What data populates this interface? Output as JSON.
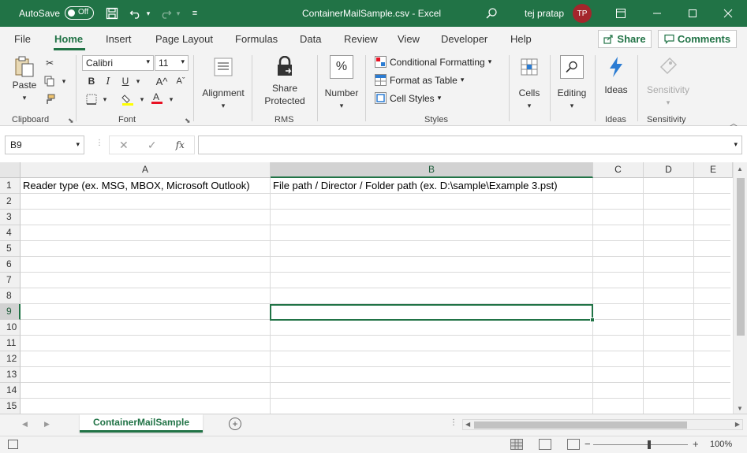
{
  "titlebar": {
    "autosave_label": "AutoSave",
    "autosave_state": "Off",
    "title": "ContainerMailSample.csv  -  Excel",
    "user_name": "tej pratap",
    "user_initials": "TP"
  },
  "tabs": [
    "File",
    "Home",
    "Insert",
    "Page Layout",
    "Formulas",
    "Data",
    "Review",
    "View",
    "Developer",
    "Help"
  ],
  "active_tab": "Home",
  "share_label": "Share",
  "comments_label": "Comments",
  "ribbon": {
    "clipboard": {
      "paste": "Paste",
      "label": "Clipboard"
    },
    "font": {
      "name": "Calibri",
      "size": "11",
      "label": "Font"
    },
    "alignment": {
      "label": "Alignment"
    },
    "rms": {
      "share_protected_1": "Share",
      "share_protected_2": "Protected",
      "label": "RMS"
    },
    "number": {
      "label": "Number"
    },
    "styles": {
      "conditional": "Conditional Formatting",
      "format_table": "Format as Table",
      "cell_styles": "Cell Styles",
      "label": "Styles"
    },
    "cells": {
      "label": "Cells"
    },
    "editing": {
      "label": "Editing"
    },
    "ideas": {
      "button": "Ideas",
      "label": "Ideas"
    },
    "sensitivity": {
      "button": "Sensitivity",
      "label": "Sensitivity"
    }
  },
  "formula_bar": {
    "name_box": "B9",
    "value": ""
  },
  "grid": {
    "columns": [
      "A",
      "B",
      "C",
      "D",
      "E"
    ],
    "rows": [
      "1",
      "2",
      "3",
      "4",
      "5",
      "6",
      "7",
      "8",
      "9",
      "10",
      "11",
      "12",
      "13",
      "14",
      "15"
    ],
    "cells": {
      "A1": "Reader type (ex. MSG, MBOX, Microsoft Outlook)",
      "B1": "File path / Director / Folder path (ex. D:\\sample\\Example 3.pst)"
    },
    "selected_cell": "B9"
  },
  "sheet": {
    "name": "ContainerMailSample"
  },
  "status": {
    "zoom": "100%"
  },
  "colors": {
    "accent": "#217346",
    "avatar": "#a4262c"
  }
}
